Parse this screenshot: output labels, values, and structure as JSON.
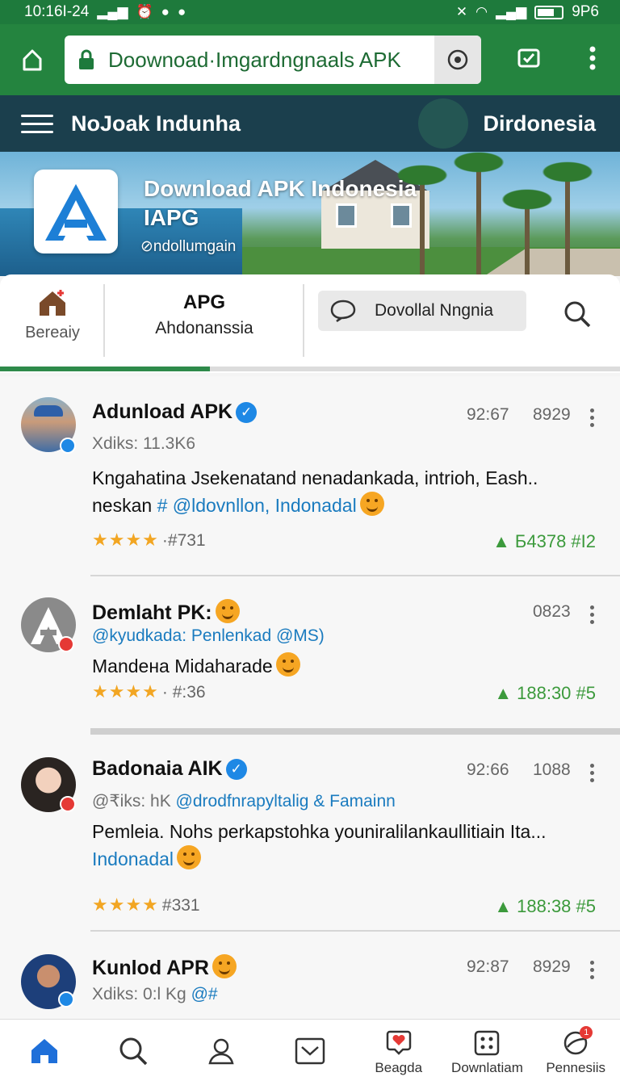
{
  "status_bar": {
    "time": "10:16I-24",
    "right_text": "9P6",
    "icons": [
      "signal-icon",
      "alarm-icon",
      "skype-icon",
      "chat-icon",
      "mute-icon",
      "wifi-icon",
      "battery-icon"
    ]
  },
  "browser": {
    "url": "Doownoad·Imgardngnaals APK",
    "icons": [
      "home-icon",
      "lock-icon",
      "record-icon",
      "tab-check-icon",
      "menu-icon"
    ]
  },
  "header": {
    "title": "NoJoak Indunha",
    "region": "Dirdonesia"
  },
  "hero": {
    "title_line1": "Download APK Indonesia",
    "title_line2": "IAPG",
    "subtitle": "⊘ndollumgain"
  },
  "tabs": {
    "home_label": "Bereaiy",
    "apg_title": "APG",
    "apg_subtitle": "Ahdonanssia",
    "download_label": "Dovollal Nngnia"
  },
  "posts": [
    {
      "name": "Adunload APK",
      "verified": true,
      "time": "92:67",
      "count": "8929",
      "meta": "Xdiks: 11.3K6",
      "body_text": "Kngahatina Jsekenatand nenadankada, intrioh, Eash.. neskan ",
      "body_link": "# @ldovnllon, Indonadal",
      "stars": "★★★★",
      "rank": "·#731",
      "likes": "Б4378 #I2"
    },
    {
      "name": "Demlaht PK:",
      "verified": false,
      "time": "0823",
      "count": "",
      "meta_link": "@kyudkada: Penlenkad @MS)",
      "body_text": "Mandeна Midaharade",
      "body_link": "",
      "stars": "★★★★",
      "rank": "· #:36",
      "likes": "188:30 #5"
    },
    {
      "name": "Badonaia AIK",
      "verified": true,
      "time": "92:66",
      "count": "1088",
      "meta": "@₹iks: hK ",
      "meta_link": "@drodfnrapyltalig & Famainn",
      "body_text": "Pemleia. Nohs perkapstohka youniralilankaullitiain Ita...",
      "body_link": "Indonadal",
      "stars": "★★★★",
      "rank": "#331",
      "likes": "188:38 #5"
    },
    {
      "name": "Kunlod APR",
      "verified": false,
      "time": "92:87",
      "count": "8929",
      "meta": "Xdiks: 0:l Kg ",
      "meta_link": "@#"
    }
  ],
  "bottom_nav": [
    {
      "label": "",
      "icon": "home-icon"
    },
    {
      "label": "",
      "icon": "search-icon"
    },
    {
      "label": "",
      "icon": "profile-icon"
    },
    {
      "label": "",
      "icon": "inbox-icon"
    },
    {
      "label": "Beagda",
      "icon": "heart-chat-icon"
    },
    {
      "label": "Downlatiam",
      "icon": "apps-grid-icon"
    },
    {
      "label": "Pennesiis",
      "icon": "badge-icon",
      "badge": "1"
    }
  ],
  "colors": {
    "browser_green": "#24843f",
    "header_navy": "#1b3f4d",
    "link_blue": "#1a7bbf",
    "star_gold": "#f2a623",
    "like_green": "#3c9a3c",
    "verified_blue": "#1e88e5"
  }
}
